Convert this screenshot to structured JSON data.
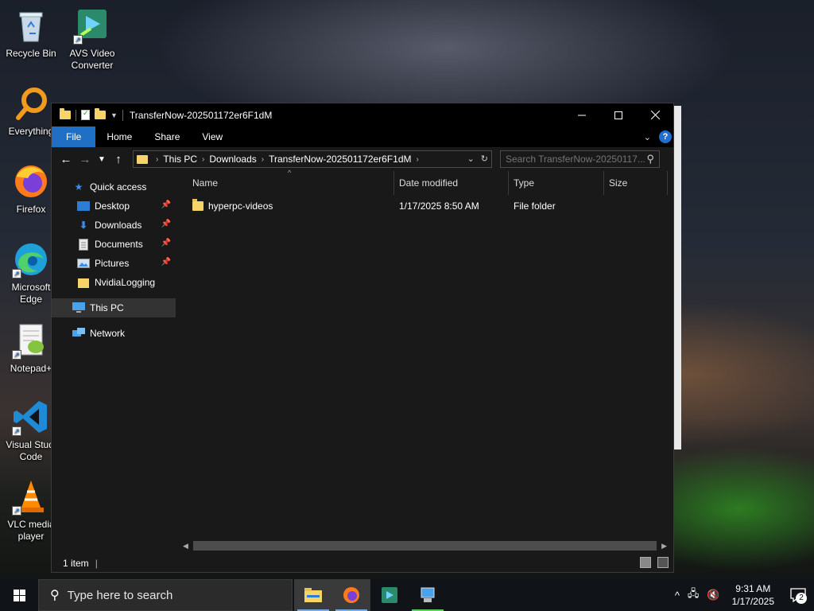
{
  "desktop": {
    "icons": [
      {
        "label": "Recycle Bin"
      },
      {
        "label": "AVS Video Converter"
      },
      {
        "label": "Everything"
      },
      {
        "label": "Firefox"
      },
      {
        "label": "Microsoft Edge"
      },
      {
        "label": "Notepad+"
      },
      {
        "label": "Visual Studi Code"
      },
      {
        "label": "VLC media player"
      }
    ]
  },
  "window": {
    "title": "TransferNow-202501172er6F1dM",
    "ribbon_tabs": [
      "File",
      "Home",
      "Share",
      "View"
    ],
    "help": "?",
    "breadcrumbs": [
      "This PC",
      "Downloads",
      "TransferNow-202501172er6F1dM"
    ],
    "search_placeholder": "Search TransferNow-20250117...",
    "nav": {
      "quick_access": "Quick access",
      "quick_items": [
        {
          "label": "Desktop",
          "pinned": true
        },
        {
          "label": "Downloads",
          "pinned": true
        },
        {
          "label": "Documents",
          "pinned": true
        },
        {
          "label": "Pictures",
          "pinned": true
        },
        {
          "label": "NvidiaLogging",
          "pinned": false
        }
      ],
      "this_pc": "This PC",
      "network": "Network"
    },
    "columns": [
      "Name",
      "Date modified",
      "Type",
      "Size"
    ],
    "rows": [
      {
        "name": "hyperpc-videos",
        "date": "1/17/2025 8:50 AM",
        "type": "File folder",
        "size": ""
      }
    ],
    "status": "1 item"
  },
  "taskbar": {
    "search_placeholder": "Type here to search",
    "time": "9:31 AM",
    "date": "1/17/2025",
    "notifications": "2"
  },
  "colors": {
    "accent": "#1f6fc4",
    "folder": "#f7d467",
    "window_bg": "#191919"
  }
}
